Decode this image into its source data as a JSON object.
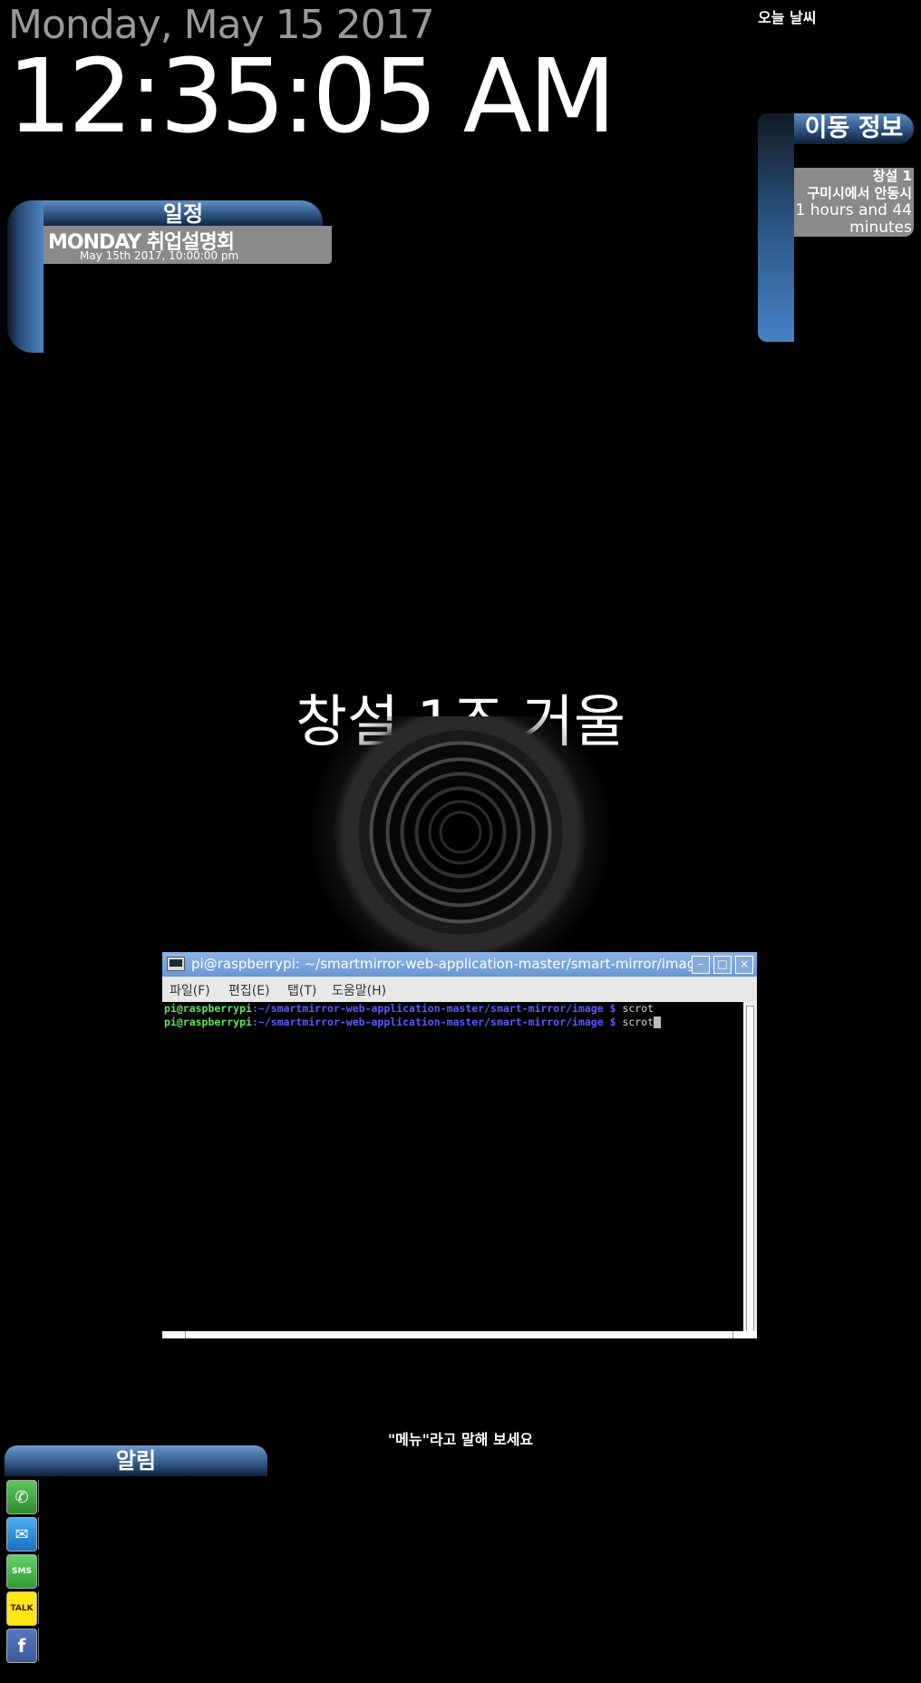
{
  "clock": {
    "date": "Monday, May 15 2017",
    "time": "12:35:05 AM"
  },
  "weather": {
    "title": "오늘 날씨"
  },
  "schedule": {
    "title": "일정",
    "events": [
      {
        "event": "MONDAY   취업설명회",
        "when": "May 15th 2017, 10:00:00 pm"
      }
    ]
  },
  "traffic": {
    "title": "이동 정보",
    "route": "창설 1",
    "description": "구미시에서 안동시",
    "duration_line1": "1 hours and 44",
    "duration_line2": "minutes"
  },
  "mirror": {
    "title": "창설 1조 거울"
  },
  "terminal": {
    "title": "pi@raspberrypi: ~/smartmirror-web-application-master/smart-mirror/image",
    "menu": [
      "파일(F)",
      "편집(E)",
      "탭(T)",
      "도움말(H)"
    ],
    "lines": [
      {
        "user": "pi@raspberrypi",
        "path": ":~/smartmirror-web-application-master/smart-mirror/image $",
        "cmd": " scrot"
      },
      {
        "user": "pi@raspberrypi",
        "path": ":~/smartmirror-web-application-master/smart-mirror/image $",
        "cmd": " scrot"
      }
    ],
    "buttons": {
      "minimize": "–",
      "maximize": "□",
      "close": "×"
    }
  },
  "voice": {
    "prompt": "\"메뉴\"라고 말해 보세요"
  },
  "notifications": {
    "title": "알림",
    "icons": [
      {
        "name": "whatsapp-icon",
        "glyph": "✆"
      },
      {
        "name": "mail-icon",
        "glyph": "✉"
      },
      {
        "name": "sms-icon",
        "glyph": "SMS"
      },
      {
        "name": "kakaotalk-icon",
        "glyph": "TALK"
      },
      {
        "name": "facebook-icon",
        "glyph": "f"
      }
    ]
  }
}
